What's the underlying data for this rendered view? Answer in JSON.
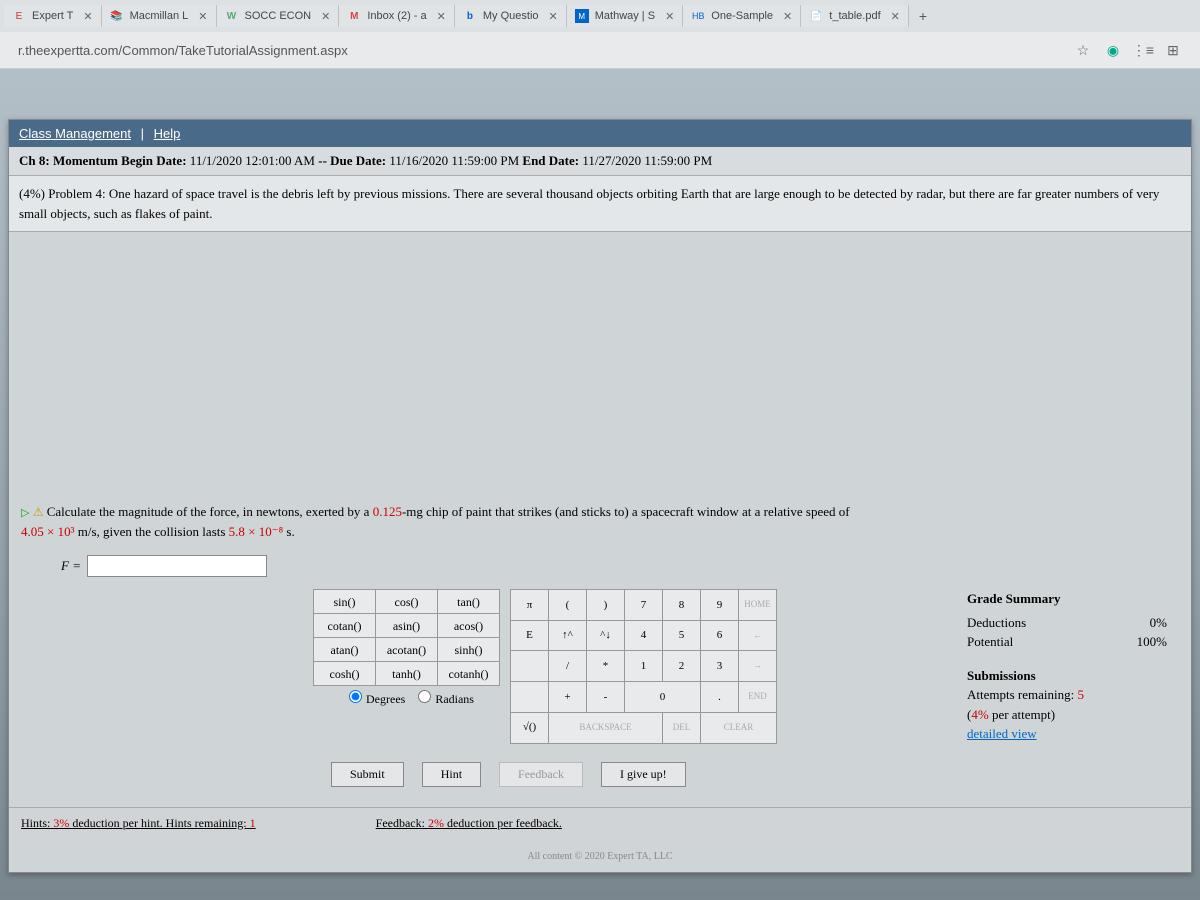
{
  "tabs": [
    {
      "icon": "E",
      "label": "Expert T",
      "iconColor": "#c33"
    },
    {
      "icon": "📚",
      "label": "Macmillan L",
      "iconColor": "#b44"
    },
    {
      "icon": "W",
      "label": "SOCC ECON",
      "iconColor": "#5a7"
    },
    {
      "icon": "M",
      "label": "Inbox (2) - a",
      "iconColor": "#d44"
    },
    {
      "icon": "b",
      "label": "My Questio",
      "iconColor": "#06c"
    },
    {
      "icon": "M",
      "label": "Mathway | S",
      "iconColor": "#06c"
    },
    {
      "icon": "HB",
      "label": "One-Sample",
      "iconColor": "#06c"
    },
    {
      "icon": "📄",
      "label": "t_table.pdf",
      "iconColor": "#888"
    }
  ],
  "url": "r.theexpertta.com/Common/TakeTutorialAssignment.aspx",
  "nav": {
    "classMgmt": "Class Management",
    "help": "Help"
  },
  "chapter": {
    "prefix": "Ch 8: Momentum Begin Date:",
    "beginDate": "11/1/2020 12:01:00 AM",
    "dueLabel": "-- Due Date:",
    "dueDate": "11/16/2020 11:59:00 PM",
    "endLabel": "End Date:",
    "endDate": "11/27/2020 11:59:00 PM"
  },
  "problem": {
    "label": "(4%) Problem 4:",
    "text": "One hazard of space travel is the debris left by previous missions. There are several thousand objects orbiting Earth that are large enough to be detected by radar, but there are far greater numbers of very small objects, such as flakes of paint."
  },
  "question": {
    "pre": "Calculate the magnitude of the force, in newtons, exerted by a ",
    "mass": "0.125",
    "mid1": "-mg chip of paint that strikes (and sticks to) a spacecraft window at a relative speed of ",
    "speed": "4.05 × 10³",
    "mid2": " m/s, given the collision lasts ",
    "time": "5.8 × 10⁻⁸",
    "end": " s."
  },
  "answer": {
    "label": "F =",
    "value": ""
  },
  "funcs": {
    "r0": [
      "sin()",
      "cos()",
      "tan()"
    ],
    "r1": [
      "cotan()",
      "asin()",
      "acos()"
    ],
    "r2": [
      "atan()",
      "acotan()",
      "sinh()"
    ],
    "r3": [
      "cosh()",
      "tanh()",
      "cotanh()"
    ]
  },
  "nums": {
    "r0": [
      "π",
      "(",
      ")",
      "7",
      "8",
      "9",
      "HOME"
    ],
    "r1": [
      "E",
      "↑^",
      "^↓",
      "4",
      "5",
      "6",
      "←"
    ],
    "r2": [
      "",
      "/",
      "*",
      "1",
      "2",
      "3",
      "→"
    ],
    "r3": [
      "",
      "+",
      "-",
      "0",
      ".",
      "END"
    ],
    "r4": [
      "√()",
      "BACKSPACE",
      "DEL",
      "CLEAR"
    ]
  },
  "modes": {
    "deg": "Degrees",
    "rad": "Radians"
  },
  "grade": {
    "title": "Grade Summary",
    "dedLabel": "Deductions",
    "dedVal": "0%",
    "potLabel": "Potential",
    "potVal": "100%",
    "subTitle": "Submissions",
    "attemptsLabel": "Attempts remaining:",
    "attemptsVal": "5",
    "perAttempt": "(4% per attempt)",
    "detail": "detailed view"
  },
  "actions": {
    "submit": "Submit",
    "hint": "Hint",
    "feedback": "Feedback",
    "giveup": "I give up!"
  },
  "hints": {
    "label": "Hints:",
    "pct": "3%",
    "text": "deduction per hint. Hints remaining:",
    "remaining": "1",
    "fbLabel": "Feedback:",
    "fbPct": "2%",
    "fbText": "deduction per feedback."
  },
  "copyright": "All content © 2020 Expert TA, LLC"
}
